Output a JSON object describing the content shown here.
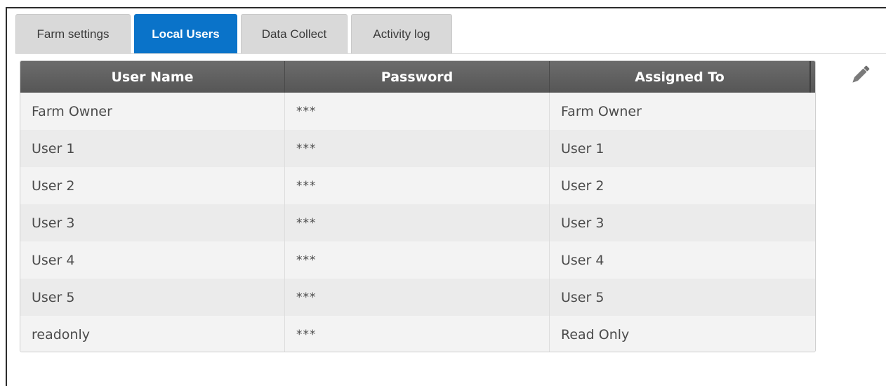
{
  "tabs": [
    {
      "label": "Farm settings",
      "active": false
    },
    {
      "label": "Local Users",
      "active": true
    },
    {
      "label": "Data Collect",
      "active": false
    },
    {
      "label": "Activity log",
      "active": false
    }
  ],
  "table": {
    "headers": [
      "User Name",
      "Password",
      "Assigned To"
    ],
    "rows": [
      [
        "Farm Owner",
        "***",
        "Farm Owner"
      ],
      [
        "User 1",
        "***",
        "User 1"
      ],
      [
        "User 2",
        "***",
        "User 2"
      ],
      [
        "User 3",
        "***",
        "User 3"
      ],
      [
        "User 4",
        "***",
        "User 4"
      ],
      [
        "User 5",
        "***",
        "User 5"
      ],
      [
        "readonly",
        "***",
        "Read Only"
      ]
    ]
  },
  "icons": {
    "edit": "pencil-icon"
  },
  "colors": {
    "active_tab": "#0a73c9",
    "inactive_tab": "#d9d9d9",
    "header_bg": "#5f5f5f"
  }
}
